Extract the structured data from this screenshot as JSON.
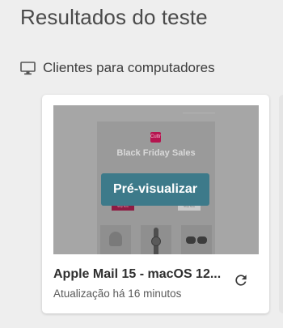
{
  "page": {
    "title": "Resultados do teste"
  },
  "section": {
    "icon": "desktop-monitor-icon",
    "title": "Clientes para computadores"
  },
  "card": {
    "client_name": "Apple Mail 15 - macOS 12...",
    "updated_text": "Atualização há 16 minutos",
    "preview_button_label": "Pré-visualizar",
    "refresh_icon": "refresh-icon",
    "preview": {
      "logo_text": "Cuttr",
      "headline": "Black Friday Sales",
      "button_left": "Shop Now",
      "button_right": "Shop Now"
    }
  },
  "colors": {
    "background": "#eeeeee",
    "card": "#ffffff",
    "preview_button": "#3d7a8a",
    "email_brand": "#b5144f"
  }
}
